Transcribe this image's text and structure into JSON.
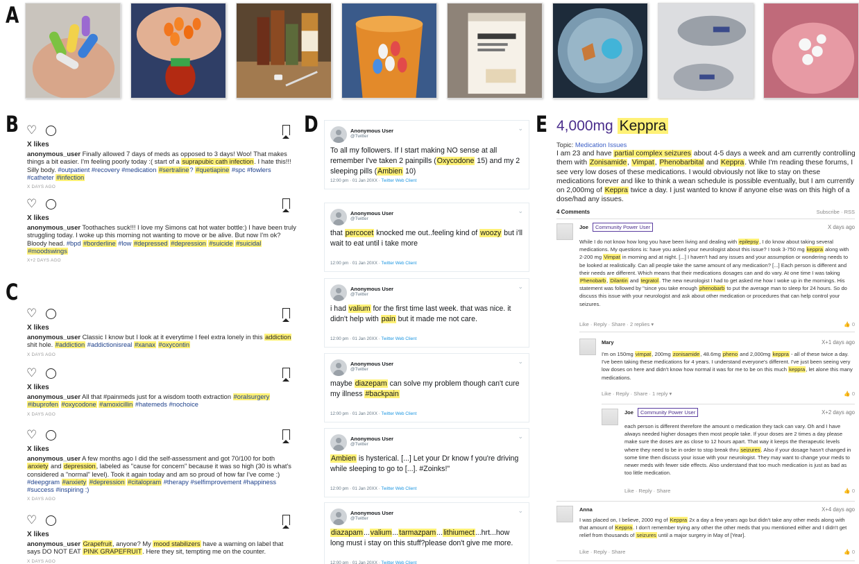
{
  "panels": {
    "a": "A",
    "b": "B",
    "c": "C",
    "d": "D",
    "e": "E"
  },
  "photos": [
    {
      "name": "colorful-pills-in-hand"
    },
    {
      "name": "orange-capsules-in-hand"
    },
    {
      "name": "medicine-bottles-on-table"
    },
    {
      "name": "pill-bottle-with-capsules"
    },
    {
      "name": "prozac-box"
    },
    {
      "name": "two-pills-on-plate"
    },
    {
      "name": "grey-oval-tablets"
    },
    {
      "name": "white-pills-in-palm"
    }
  ],
  "instagram": {
    "likes": "X likes",
    "posts": [
      {
        "user": "anonymous_user",
        "pre": " Finally allowed 7 days of meds as opposed to 3 days! Woo! That makes things a bit easier. I'm feeling poorly today :( start of a ",
        "h1": "suprapubic cath infection",
        "mid": ". I hate this!!! Silly body. ",
        "tags1": "#outpatient #recovery #medication ",
        "h2": "#sertraline",
        "tags2": "? ",
        "h3": "#quetiapine",
        "tags3": " #spc #fowlers #catheter ",
        "h4": "#infection",
        "ago": "X DAYS AGO"
      },
      {
        "user": "anonymous_user",
        "pre": " Toothaches suck!!! I love my Simons cat hot water bottle:) I have been truly struggling today. I woke up this morning not wanting to move or be alive. But now I'm ok? Bloody head. ",
        "tags1": "#bpd ",
        "h1": "#borderline",
        "tags2": " #low ",
        "h2": "#depressed",
        "h3": "#depression",
        "h4": "#suicide",
        "h5": "#suicidal",
        "h6": "#moodswings",
        "ago": "X+2 DAYS AGO"
      },
      {
        "user": "anonymous_user",
        "pre": " Classic I know but I look at it everytime I feel extra lonely in this ",
        "h1": "addiction",
        "mid": " shit hole. ",
        "h2": "#addiction",
        "tags1": " #addictionisreal ",
        "h3": "#xanax",
        "h4": "#oxycontin",
        "ago": "X DAYS AGO"
      },
      {
        "user": "anonymous_user",
        "pre": " All that #painmeds just for a wisdom tooth extraction ",
        "h1": "#oralsurgery",
        "h2": "#ibuprofen",
        "h3": "#oxycodone",
        "h4": "#amoxicillin",
        "tags1": " #hatemeds #nochoice",
        "ago": "X DAYS AGO"
      },
      {
        "user": "anonymous_user",
        "pre": " A few months ago I did the self-assessment and got 70/100 for both ",
        "h1": "anxiety",
        "mid1": " and ",
        "h2": "depression",
        "mid2": ", labeled as \"cause for concern\" because it was so high (30 is what's considered a \"normal\" level). Took it again today and am so proud of how far I've come :) ",
        "tags1": "#deepgram ",
        "h3": "#anxiety",
        "h4": "#depression",
        "h5": "#citalopram",
        "tags2": " #therapy #selfimprovement #happiness #success #inspiring :)",
        "ago": "X DAYS AGO"
      },
      {
        "user": "anonymous_user",
        "h1": "Grapefruit",
        "mid1": ", anyone? My ",
        "h2": "mood stabilizers",
        "mid2": " have a warning on label that says DO NOT EAT ",
        "h3": "PINK GRAPEFRUIT",
        "mid3": ". Here they sit, tempting me on the counter.",
        "ago": "X DAYS AGO"
      }
    ]
  },
  "twitter": {
    "user": "Anonymous User",
    "handle": "@Twitter",
    "time": "12:00 pm · 01 Jan 20XX · ",
    "client": "Twitter Web Client",
    "tweets": [
      {
        "t1": "To all my followers. If I start making NO sense at all remember I've taken 2 painpills (",
        "h1": "Oxycodone",
        "t2": " 15) and my 2 sleeping pills (",
        "h2": "Ambien",
        "t3": " 10)"
      },
      {
        "t0": "that ",
        "h1": "percocet",
        "t1": " knocked me out..feeling kind of ",
        "h2": "woozy",
        "t2": " but i'll wait to eat until i take more"
      },
      {
        "t0": "i had ",
        "h1": "valium",
        "t1": " for the first time last week. that was nice. it didn't help with ",
        "h2": "pain",
        "t2": " but it made me not care."
      },
      {
        "t0": "maybe ",
        "h1": "diazepam",
        "t1": " can solve my problem though can't cure my illness ",
        "h2": "#backpain"
      },
      {
        "h1": "Ambien",
        "t1": " is hysterical. [...] Let your Dr know f you're driving while sleeping to go to [...]. #Zoinks!\""
      },
      {
        "h1": "diazapam",
        "s1": "...",
        "h2": "valium",
        "s2": "...",
        "h3": "tarmazpam",
        "s3": "...",
        "h4": "lithiumect",
        "t1": "...hrt...how long must i stay on this stuff?please don't give me more."
      }
    ]
  },
  "forum": {
    "title_pre": "4,000mg",
    "title_hl": "Keppra",
    "topic_label": "Topic: ",
    "topic_link": "Medication Issues",
    "body": {
      "t1": "I am 23 and have ",
      "h1": "partial complex seizures",
      "t2": " about 4-5 days a week and am currently controlling them with ",
      "h2": "Zonisamide",
      "c1": ", ",
      "h3": "Vimpat",
      "c2": ", ",
      "h4": "Phenobarbital",
      "c3": " and ",
      "h5": "Keppra",
      "t3": ". While I'm reading these forums, I see very low doses of these medications. I would obviously not like to stay on these medications forever and like to think a wean schedule is possible eventually, but I am currently on 2,000mg of ",
      "h6": "Keppra",
      "t4": " twice a day. I just wanted to know if anyone else was on this high of a dose/had any issues."
    },
    "comments_count": "4 Comments",
    "subscribe": "Subscribe · RSS",
    "badge": "Community Power User",
    "thumb": "👍 0",
    "c1": {
      "name": "Joe",
      "date": "X days ago",
      "t1": "While I do not know how long you have been living and dealing with ",
      "h1": "epilepsy",
      "t2": ", I do know about taking several medications. My questions is: have you asked your neurologist about this issue? I took 3-750 mg ",
      "h2": "keppra",
      "t3": " along with 2-200 mg ",
      "h3": "Vimpat",
      "t4": " in morning and at night. [...] I haven't had any issues and your assumption or wondering needs to be looked at realistically. Can all people take the same amount of any medication? [...] Each person is different and their needs are different. Which means that their medications dosages can and do vary. At one time I was taking ",
      "h4": "Phenobarb",
      "c1": ", ",
      "h5": "Dilantin",
      "c2": " and ",
      "h6": "tegratol",
      "t5": ". The new neurologist I had to get asked me how I woke up in the mornings. His statement was followed by \"since you take enough ",
      "h7": "phenobarb",
      "t6": " to put the average man to sleep for 24 hours. So do discuss this issue with your neurologist and ask about other medication or procedures that can help control your seizures.",
      "actions": "Like · Reply · Share · 2 replies ▾"
    },
    "c2": {
      "name": "Mary",
      "date": "X+1 days ago",
      "t1": "I'm on 150mg ",
      "h1": "vimpat",
      "t2": ", 200mg ",
      "h2": "zonisamide",
      "t3": ", 48.6mg ",
      "h3": "pheno",
      "t4": " and 2,000mg ",
      "h4": "keppra",
      "t5": " - all of these twice a day. I've been taking these medications for 4 years. I understand everyone's different. I've just been seeing very low doses on here and didn't know how normal it was for me to be on this much ",
      "h5": "keppra",
      "t6": ", let alone this many medications.",
      "actions": "Like · Reply · Share · 1 reply ▾"
    },
    "c3": {
      "name": "Joe",
      "date": "X+2 days ago",
      "t1": "each person is different therefore the amount o medication they tack can vary. Oh and I have always needed higher dosages then most people take. If your doses are 2 times a day please make sure the doses are as close to 12 hours apart. That way it keeps the therapeutic levels where they need to be in order to stop break thru ",
      "h1": "seizures",
      "t2": ". Also if your dosage hasn't changed in some time then discuss your issue with your neurologist. They may want to change your meds to newer meds with fewer side effects. Also understand that too much medication is just as bad as too little medication.",
      "actions": "Like · Reply · Share"
    },
    "c4": {
      "name": "Anna",
      "date": "X+4 days ago",
      "t1": "I was placed on, I believe, 2000 mg of ",
      "h1": "Keppra",
      "t2": " 2x a day a few years ago but didn't take any other meds along with that amount of ",
      "h2": "Keppra",
      "t3": ". I don't remember trying any other the other meds that you mentioned either and I didn't get relief from thousands of ",
      "h3": "seizures",
      "t4": " until a major surgery in May of [Year].",
      "actions": "Like · Reply · Share"
    }
  }
}
